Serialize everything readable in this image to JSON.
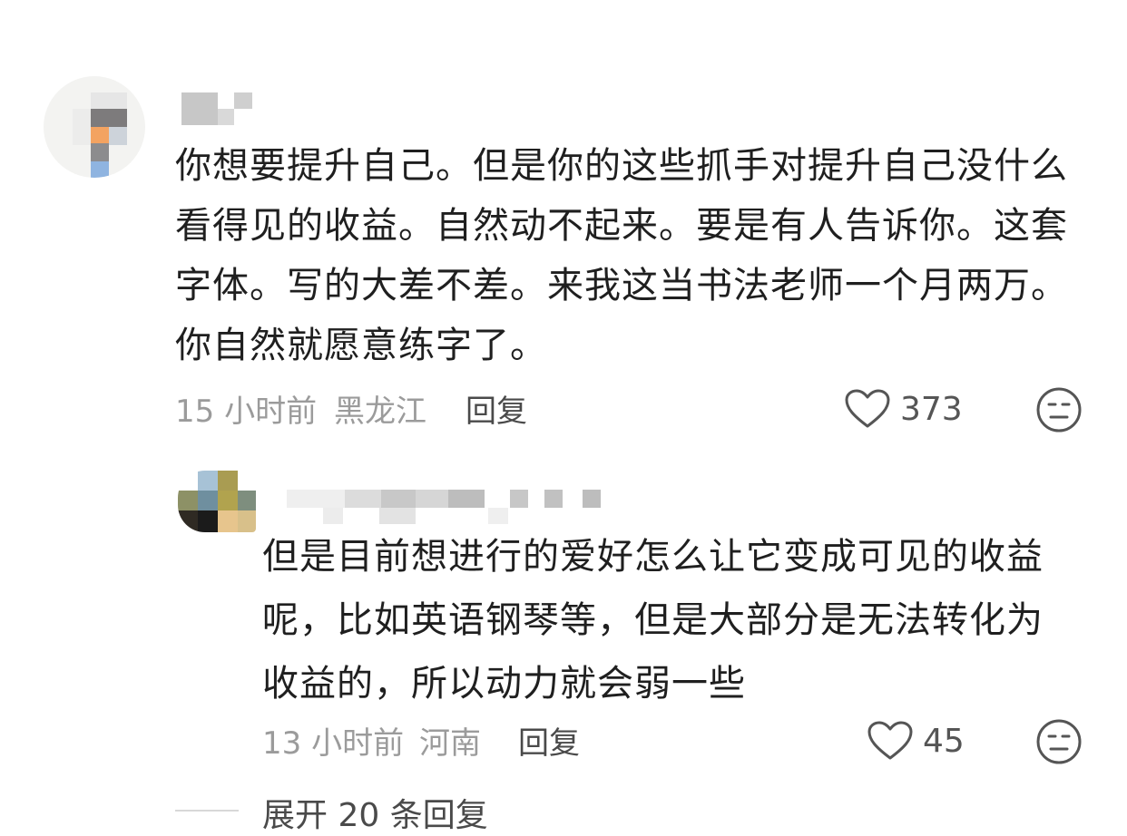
{
  "comment": {
    "lines": [
      "你想要提升自己。但是你的这些抓手对提升自己没什么",
      "看得见的收益。自然动不起来。要是有人告诉你。这套",
      "字体。写的大差不差。来我这当书法老师一个月两万。",
      "你自然就愿意练字了。"
    ],
    "time": "15 小时前",
    "location": "黑龙江",
    "reply_label": "回复",
    "likes": "373",
    "reaction_icon": "neutral-face-icon"
  },
  "reply": {
    "lines": [
      "但是目前想进行的爱好怎么让它变成可见的收益",
      "呢，比如英语钢琴等，但是大部分是无法转化为",
      "收益的，所以动力就会弱一些"
    ],
    "time": "13 小时前",
    "location": "河南",
    "reply_label": "回复",
    "likes": "45",
    "reaction_icon": "neutral-face-icon"
  },
  "expand": {
    "label": "展开 20 条回复"
  },
  "colors": {
    "text": "#1f1f1f",
    "meta": "#9b9b9b",
    "icon": "#555555"
  }
}
